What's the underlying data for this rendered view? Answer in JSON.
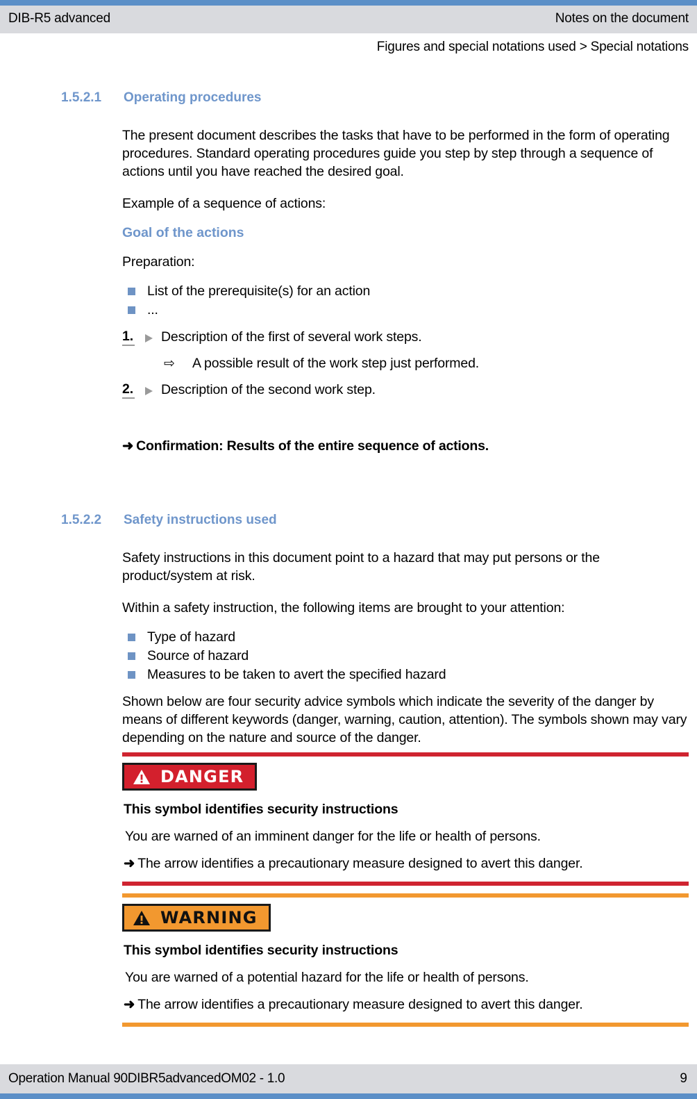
{
  "header": {
    "left_title": "DIB-R5 advanced",
    "right_title": "Notes on the document",
    "breadcrumb": "Figures and special notations used > Special notations"
  },
  "sections": [
    {
      "number": "1.5.2.1",
      "title": "Operating procedures",
      "paragraphs": [
        "The present document describes the tasks that have to be performed in the form of operating procedures. Standard operating procedures guide you step by step through a sequence of actions until you have reached the desired goal.",
        "Example of a sequence of actions:"
      ],
      "goal_heading": "Goal of the actions",
      "preparation_label": "Preparation:",
      "prerequisites": [
        "List of the prerequisite(s) for an action",
        "..."
      ],
      "steps": [
        {
          "number": "1.",
          "text": "Description of the first of several work steps."
        },
        {
          "number": "2.",
          "text": "Description of the second work step."
        }
      ],
      "substep": {
        "marker": "⇨",
        "text": "A possible result of the work step just performed."
      },
      "confirmation": {
        "arrow": "➜",
        "text": "Confirmation: Results of the entire sequence of actions."
      }
    },
    {
      "number": "1.5.2.2",
      "title": "Safety instructions used",
      "paragraphs": [
        "Safety instructions in this document point to a hazard that may put persons or the product/system at risk.",
        "Within a safety instruction, the following items are brought to your attention:"
      ],
      "items": [
        "Type of hazard",
        "Source of hazard",
        "Measures to be taken to avert the specified hazard"
      ],
      "closing_paragraph": "Shown below are four security advice symbols which indicate the severity of the danger by means of different keywords (danger, warning, caution, attention). The symbols shown may vary depending on the nature and source of the danger."
    }
  ],
  "safety_blocks": [
    {
      "id": "danger",
      "badge_label": "DANGER",
      "badge_bg": "#d3202d",
      "badge_fg": "#ffffff",
      "rule_color": "#cf2430",
      "title": "This symbol identifies security instructions",
      "text": "You are warned of an imminent danger for the life or health of persons.",
      "arrow": "➜",
      "arrow_text": "The arrow identifies a precautionary measure designed to avert this danger."
    },
    {
      "id": "warning",
      "badge_label": "WARNING",
      "badge_bg": "#f2982f",
      "badge_fg": "#111111",
      "rule_color": "#f2982f",
      "title": "This symbol identifies security instructions",
      "text": "You are warned of a potential hazard for the life or health of persons.",
      "arrow": "➜",
      "arrow_text": "The arrow identifies a precautionary measure designed to avert this danger."
    }
  ],
  "footer": {
    "left": "Operation Manual 90DIBR5advancedOM02 - 1.0",
    "page_number": "9"
  },
  "colors": {
    "accent_blue": "#5b8fc7",
    "heading_blue": "#6f96cb",
    "band_gray": "#d9dade",
    "bullet_blue": "#6e93c4",
    "danger_red": "#d3202d",
    "warning_orange": "#f2982f"
  }
}
